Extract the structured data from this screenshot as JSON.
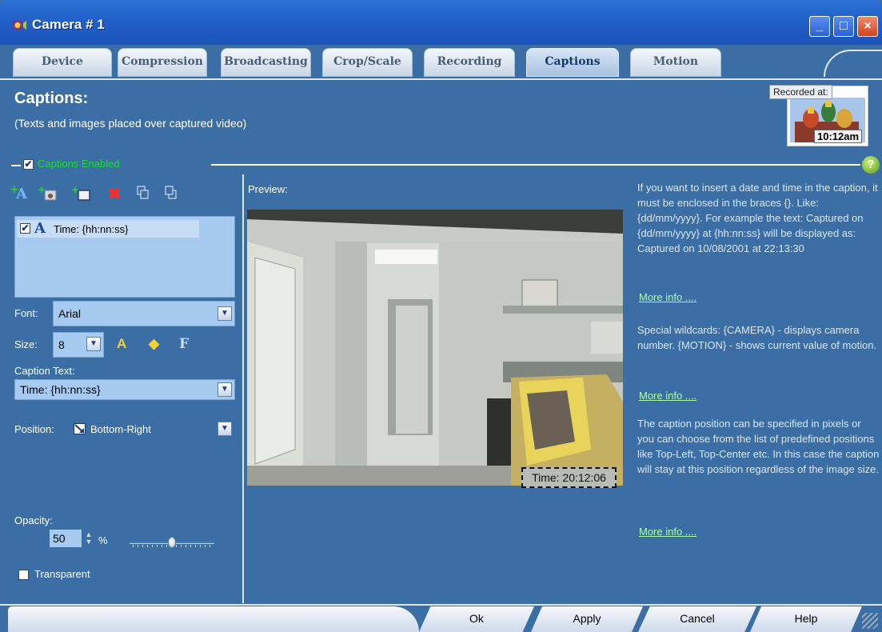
{
  "window": {
    "title": "Camera # 1",
    "min": "_",
    "max": "□",
    "close": "×"
  },
  "tabs": [
    {
      "label": "Device",
      "active": false
    },
    {
      "label": "Compression",
      "active": false
    },
    {
      "label": "Broadcasting",
      "active": false
    },
    {
      "label": "Crop/Scale",
      "active": false
    },
    {
      "label": "Recording",
      "active": false
    },
    {
      "label": "Captions",
      "active": true
    },
    {
      "label": "Motion",
      "active": false
    }
  ],
  "header": {
    "title": "Captions:",
    "subtitle": "(Texts and images placed over captured video)",
    "recorded_label": "Recorded at:",
    "recorded_time": "10:12am"
  },
  "captions_enabled": {
    "checked": true,
    "label": "Captions Enabled"
  },
  "help_glyph": "?",
  "toolbar": {
    "add_text": "add-text-icon",
    "add_image": "add-image-icon",
    "add_rectangle": "add-rectangle-icon",
    "delete": "delete-icon",
    "move_up": "move-up-icon",
    "move_down": "move-down-icon"
  },
  "caption_list": [
    {
      "checked": true,
      "type_glyph": "A",
      "text": "Time: {hh:nn:ss}"
    }
  ],
  "font": {
    "label": "Font:",
    "value": "Arial"
  },
  "size": {
    "label": "Size:",
    "value": "8",
    "bold_glyph": "F"
  },
  "caption_text": {
    "label": "Caption Text:",
    "value": "Time: {hh:nn:ss}"
  },
  "position": {
    "label": "Position:",
    "value": "Bottom-Right"
  },
  "opacity": {
    "label": "Opacity:",
    "value": "50",
    "unit": "%",
    "slider_level": 0.5
  },
  "transparent": {
    "checked": false,
    "label": "Transparent"
  },
  "preview": {
    "label": "Preview:",
    "overlay_text": "Time: 20:12:06"
  },
  "help": {
    "para1": "If you want to insert a date and time in the caption, it must be enclosed in the braces {}. Like: {dd/mm/yyyy}. For example the text: Captured on {dd/mm/yyyy} at {hh:nn:ss} will be displayed as: Captured on 10/08/2001 at 22:13:30",
    "para2": "Special wildcards: {CAMERA} - displays camera number. {MOTION} - shows current value of motion.",
    "para3": "The caption position can be specified in pixels or you can choose from the list of predefined positions like Top-Left, Top-Center etc. In this case the caption will stay at this position regardless of the image size.",
    "more_info": "More info ...."
  },
  "buttons": {
    "ok": "Ok",
    "apply": "Apply",
    "cancel": "Cancel",
    "help": "Help"
  }
}
